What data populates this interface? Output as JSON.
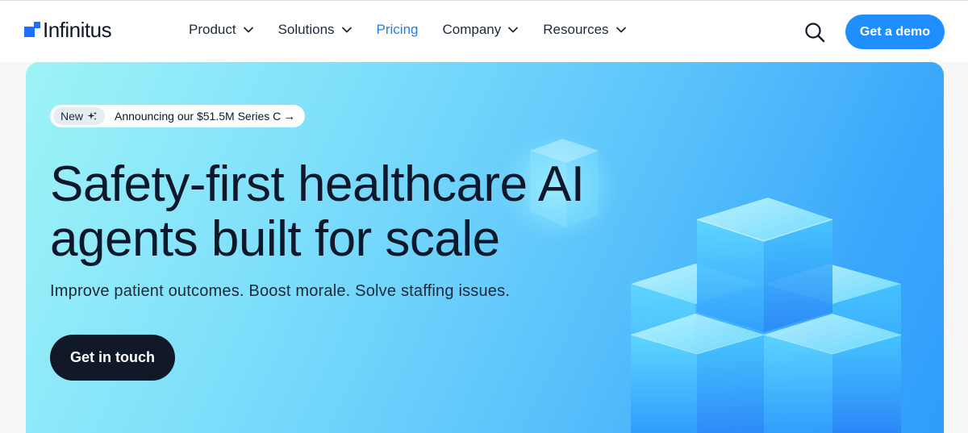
{
  "brand": {
    "name": "Infinitus",
    "color": "#1f6fff"
  },
  "nav": {
    "items": [
      {
        "label": "Product",
        "dropdown": true
      },
      {
        "label": "Solutions",
        "dropdown": true
      },
      {
        "label": "Pricing",
        "dropdown": false,
        "active": true
      },
      {
        "label": "Company",
        "dropdown": true
      },
      {
        "label": "Resources",
        "dropdown": true
      }
    ],
    "search_icon": "search-icon",
    "demo_label": "Get a demo"
  },
  "hero": {
    "badge": {
      "new_label": "New",
      "text": "Announcing our $51.5M Series C",
      "arrow": "→"
    },
    "title": "Safety-first healthcare AI agents built for scale",
    "subtitle": "Improve patient outcomes. Boost morale. Solve staffing issues.",
    "cta_label": "Get in touch"
  },
  "colors": {
    "accent": "#1f8fff",
    "active_link": "#1f7fe0",
    "cta_bg": "#111827"
  }
}
